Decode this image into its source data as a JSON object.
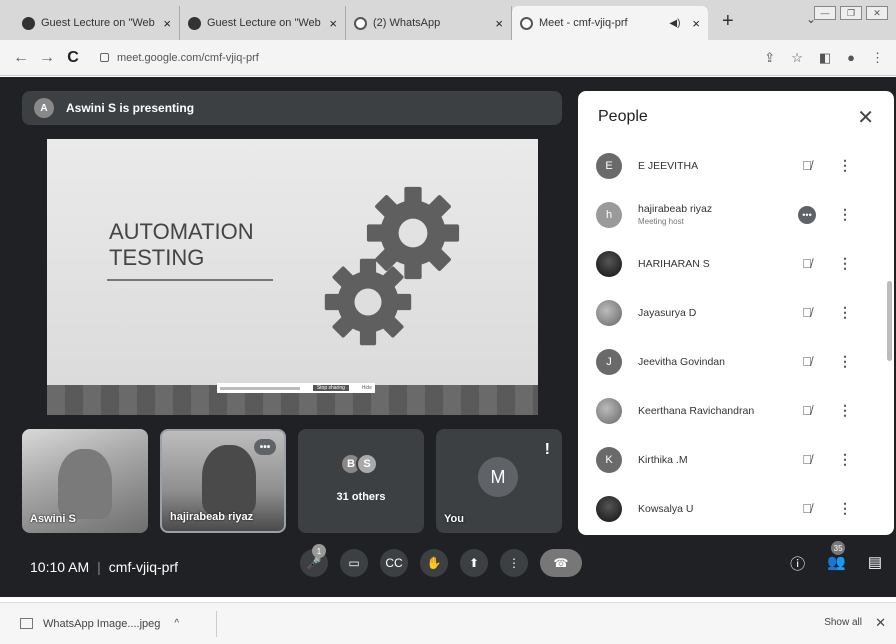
{
  "browser": {
    "tabs": [
      {
        "title": "Guest Lecture on \"Web D",
        "close": "×"
      },
      {
        "title": "Guest Lecture on \"Web D",
        "close": "×"
      },
      {
        "title": "(2) WhatsApp",
        "close": "×"
      },
      {
        "title": "Meet - cmf-vjiq-prf",
        "close": "×"
      }
    ],
    "new_tab": "+",
    "url": "meet.google.com/cmf-vjiq-prf"
  },
  "meet": {
    "presenting_avatar": "A",
    "presenting_text": "Aswini S is presenting",
    "slide": {
      "title_line1": "AUTOMATION",
      "title_line2": "TESTING",
      "notice_button": "Stop sharing",
      "notice_hide": "Hide"
    },
    "tiles": [
      {
        "name": "Aswini S"
      },
      {
        "name": "hajirabeab riyaz"
      },
      {
        "label": "31 others",
        "avatar1": "B",
        "avatar2": "S"
      },
      {
        "name": "You",
        "avatar": "M"
      }
    ],
    "time": "10:10 AM",
    "meeting_code": "cmf-vjiq-prf",
    "mic_badge": "1",
    "people_count": "35"
  },
  "people_panel": {
    "title": "People",
    "participants": [
      {
        "initial": "E",
        "name": "E JEEVITHA",
        "sub": ""
      },
      {
        "initial": "h",
        "name": "hajirabeab riyaz",
        "sub": "Meeting host"
      },
      {
        "initial": "",
        "name": "HARIHARAN S",
        "sub": ""
      },
      {
        "initial": "",
        "name": "Jayasurya D",
        "sub": ""
      },
      {
        "initial": "J",
        "name": "Jeevitha Govindan",
        "sub": ""
      },
      {
        "initial": "",
        "name": "Keerthana Ravichandran",
        "sub": ""
      },
      {
        "initial": "K",
        "name": "Kirthika .M",
        "sub": ""
      },
      {
        "initial": "",
        "name": "Kowsalya U",
        "sub": ""
      }
    ]
  },
  "download_bar": {
    "file": "WhatsApp Image....jpeg",
    "show_all": "Show all"
  }
}
